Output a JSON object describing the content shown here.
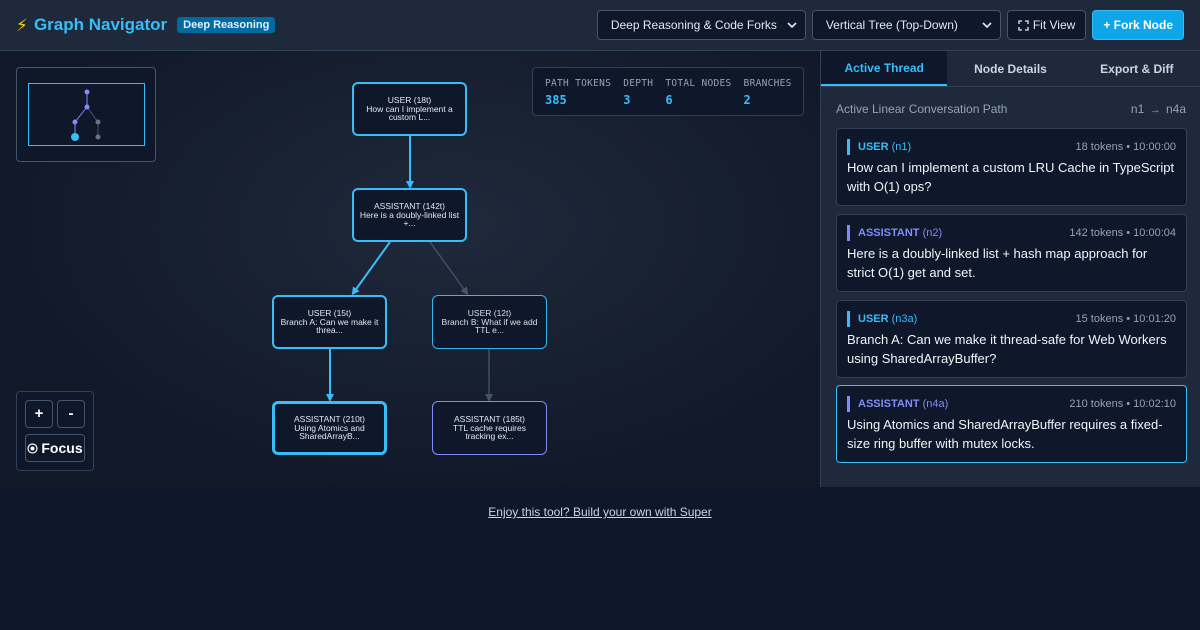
{
  "header": {
    "bolt_icon": "lightning-bolt-icon",
    "title": "Graph Navigator",
    "badge": "Deep Reasoning",
    "dataset_select": "Deep Reasoning & Code Forks",
    "layout_select": "Vertical Tree (Top-Down)",
    "fit_view": "Fit View",
    "fork_node": "+ Fork Node"
  },
  "stats": [
    {
      "label": "PATH TOKENS",
      "value": "385"
    },
    {
      "label": "DEPTH",
      "value": "3"
    },
    {
      "label": "TOTAL NODES",
      "value": "6"
    },
    {
      "label": "BRANCHES",
      "value": "2"
    }
  ],
  "graph": {
    "nodes": [
      {
        "id": "n1",
        "role": "USER (18t)",
        "snippet": "How can I implement a custom L...",
        "on_path": true
      },
      {
        "id": "n2",
        "role": "ASSISTANT (142t)",
        "snippet": "Here is a doubly-linked list +...",
        "on_path": true
      },
      {
        "id": "n3a",
        "role": "USER (15t)",
        "snippet": "Branch A: Can we make it threa...",
        "on_path": true
      },
      {
        "id": "n3b",
        "role": "USER (12t)",
        "snippet": "Branch B: What if we add TTL e...",
        "on_path": false
      },
      {
        "id": "n4a",
        "role": "ASSISTANT (210t)",
        "snippet": "Using Atomics and SharedArrayB...",
        "on_path": true
      },
      {
        "id": "n4b",
        "role": "ASSISTANT (185t)",
        "snippet": "TTL cache requires tracking ex...",
        "on_path": false
      }
    ]
  },
  "zoom": {
    "in": "+",
    "out": "-",
    "focus": "Focus"
  },
  "panel": {
    "tabs": [
      "Active Thread",
      "Node Details",
      "Export & Diff"
    ],
    "path_label": "Active Linear Conversation Path",
    "path_start": "n1",
    "path_arrow": "→",
    "path_end": "n4a",
    "messages": [
      {
        "role": "USER",
        "id": "(n1)",
        "meta": "18 tokens • 10:00:00",
        "text": "How can I implement a custom LRU Cache in TypeScript with O(1) ops?"
      },
      {
        "role": "ASSISTANT",
        "id": "(n2)",
        "meta": "142 tokens • 10:00:04",
        "text": "Here is a doubly-linked list + hash map approach for strict O(1) get and set."
      },
      {
        "role": "USER",
        "id": "(n3a)",
        "meta": "15 tokens • 10:01:20",
        "text": "Branch A: Can we make it thread-safe for Web Workers using SharedArrayBuffer?"
      },
      {
        "role": "ASSISTANT",
        "id": "(n4a)",
        "meta": "210 tokens • 10:02:10",
        "text": "Using Atomics and SharedArrayBuffer requires a fixed-size ring buffer with mutex locks."
      }
    ]
  },
  "footer": "Enjoy this tool? Build your own with Super",
  "colors": {
    "accent": "#38bdf8",
    "assistant": "#818cf8",
    "primary_button": "#0ea5e9"
  }
}
